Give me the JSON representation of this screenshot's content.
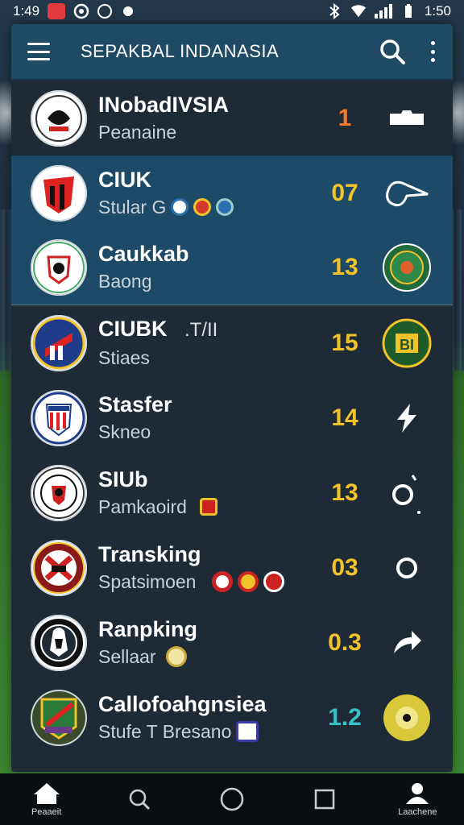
{
  "status_bar": {
    "time": "1:49",
    "battery_time": "1:50"
  },
  "app_bar": {
    "title": "SEPAKBAL INDANASIA",
    "icons": [
      "menu-icon",
      "search-icon",
      "more-vert-icon"
    ]
  },
  "rows": [
    {
      "title": "INobadIVSIA",
      "subtitle": "Peanaine",
      "number": "1",
      "number_color": "#f07a2a",
      "icon": "ticket-icon"
    },
    {
      "title": "CIUK",
      "subtitle": "Stular G",
      "number": "07",
      "number_color": "#f2c22a",
      "icon": "whistle-icon"
    },
    {
      "title": "Caukkab",
      "subtitle": "Baong",
      "number": "13",
      "number_color": "#f2c22a",
      "icon": "green-badge-icon"
    },
    {
      "title": "CIUBK",
      "title_extra": ".T/II",
      "subtitle": "Stiaes",
      "number": "15",
      "number_color": "#f2c22a",
      "icon": "bi-badge-icon"
    },
    {
      "title": "Stasfer",
      "subtitle": "Skneo",
      "number": "14",
      "number_color": "#f2c22a",
      "icon": "flash-icon"
    },
    {
      "title": "SIUb",
      "subtitle": "Pamkaoird",
      "number": "13",
      "number_color": "#f2c22a",
      "icon": "refresh-icon"
    },
    {
      "title": "Transking",
      "subtitle": "Spatsimoen",
      "number": "03",
      "number_color": "#f2c22a",
      "icon": "circle-icon"
    },
    {
      "title": "Ranpking",
      "subtitle": "Sellaar",
      "number": "0.3",
      "number_color": "#f2c22a",
      "icon": "share-icon"
    },
    {
      "title": "Callofoahgnsiea",
      "subtitle": "Stufe T Bresano",
      "number": "1.2",
      "number_color": "#36c0c8",
      "icon": "ball-icon"
    }
  ],
  "bottom_nav": [
    {
      "label": "Peaaeit",
      "icon": "home-icon"
    },
    {
      "label": "",
      "icon": "search-icon"
    },
    {
      "label": "",
      "icon": "circle-home-icon"
    },
    {
      "label": "",
      "icon": "square-recent-icon"
    },
    {
      "label": "Laachene",
      "icon": "profile-icon"
    }
  ]
}
